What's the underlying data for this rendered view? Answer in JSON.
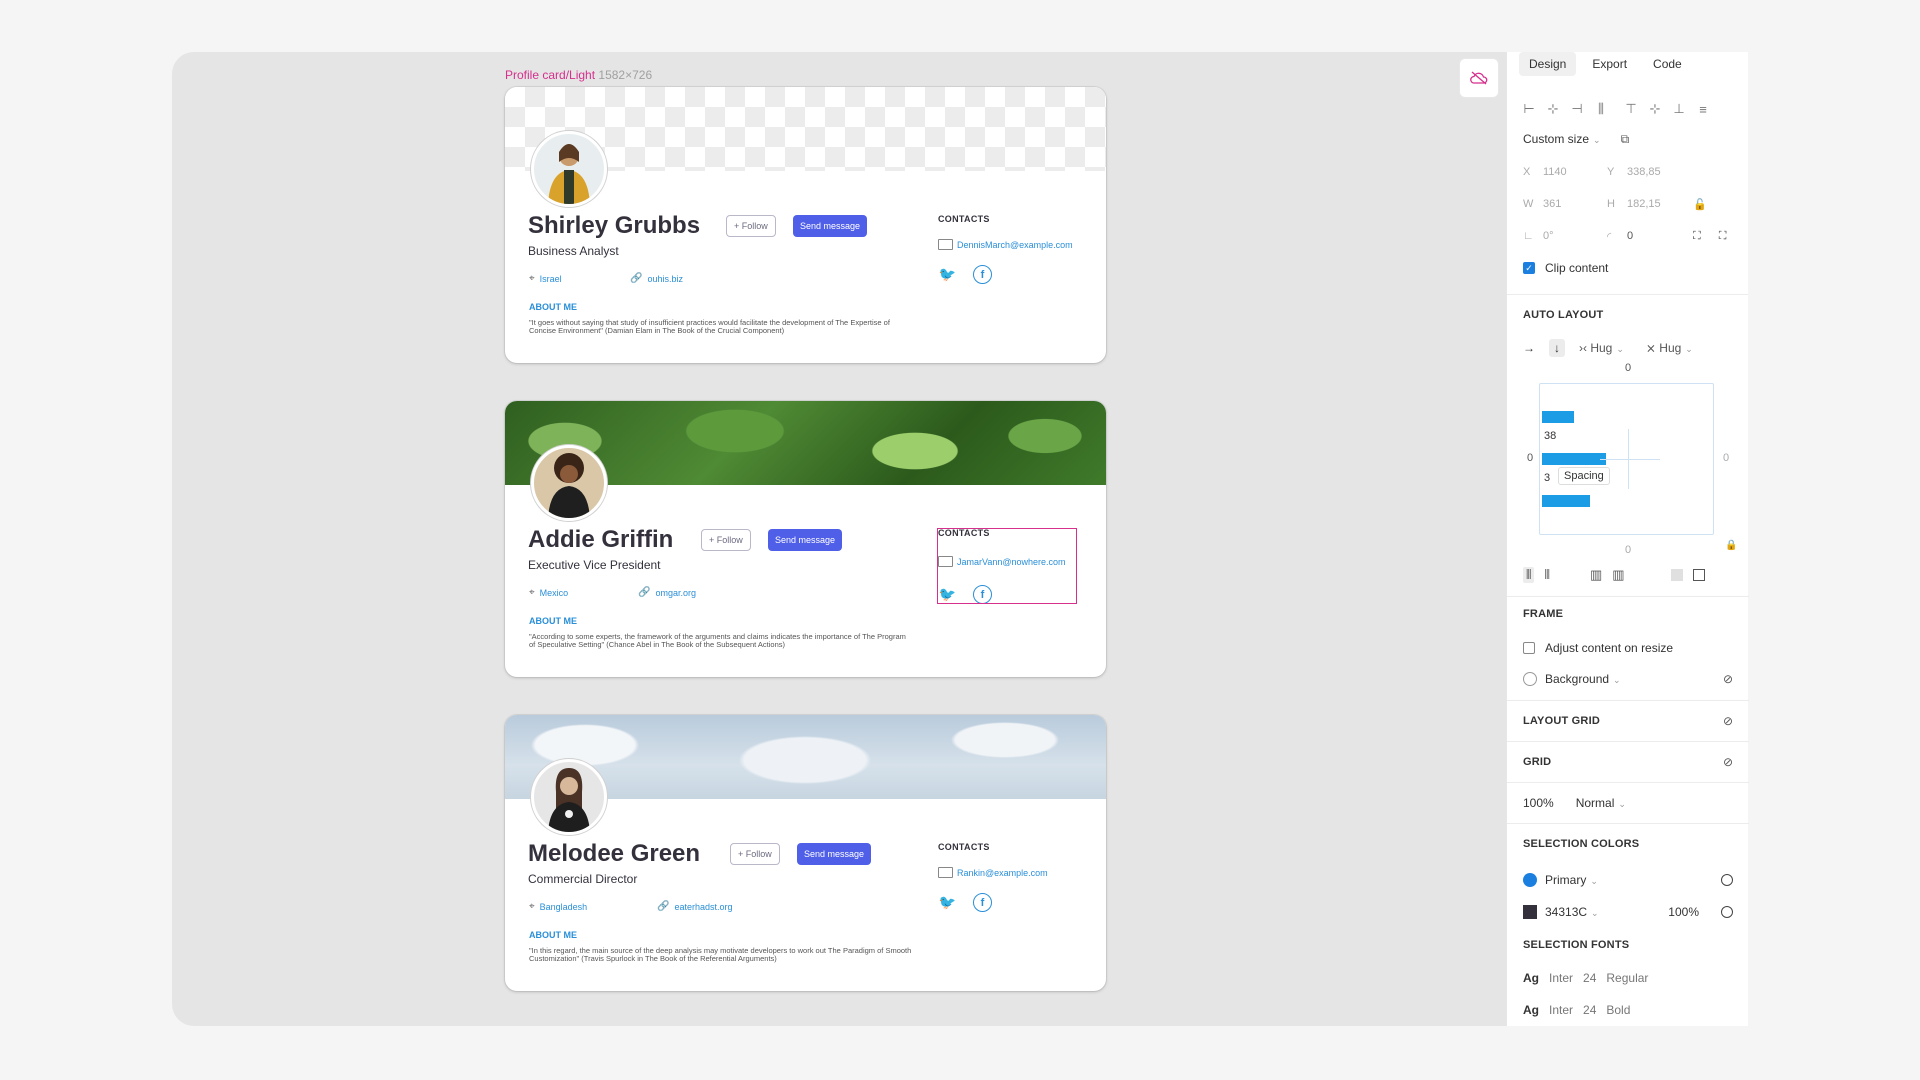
{
  "canvas": {
    "frame_label": "Profile card/Light",
    "frame_dims": "1582×726"
  },
  "cards": [
    {
      "name": "Shirley Grubbs",
      "role": "Business Analyst",
      "follow": "+ Follow",
      "message": "Send message",
      "location": "Israel",
      "website": "ouhis.biz",
      "about_heading": "ABOUT ME",
      "about": "\"It goes without saying that study of insufficient practices would facilitate the development of The Expertise of Concise Environment\" (Damian Elam in The Book of the Crucial Component)",
      "contacts_heading": "CONTACTS",
      "email": "DennisMarch@example.com"
    },
    {
      "name": "Addie Griffin",
      "role": "Executive Vice President",
      "follow": "+ Follow",
      "message": "Send message",
      "location": "Mexico",
      "website": "omgar.org",
      "about_heading": "ABOUT ME",
      "about": "\"According to some experts, the framework of the arguments and claims indicates the importance of The Program of Speculative Setting\" (Chance Abel in The Book of the Subsequent Actions)",
      "contacts_heading": "CONTACTS",
      "email": "JamarVann@nowhere.com"
    },
    {
      "name": "Melodee Green",
      "role": "Commercial Director",
      "follow": "+ Follow",
      "message": "Send message",
      "location": "Bangladesh",
      "website": "eaterhadst.org",
      "about_heading": "ABOUT ME",
      "about": "\"In this regard, the main source of the deep analysis may motivate developers to work out The Paradigm of Smooth Customization\" (Travis Spurlock in The Book of the Referential Arguments)",
      "contacts_heading": "CONTACTS",
      "email": "Rankin@example.com"
    }
  ],
  "panel": {
    "tabs": [
      "Design",
      "Export",
      "Code"
    ],
    "size_preset": "Custom size",
    "x_label": "X",
    "x_value": "1140",
    "y_label": "Y",
    "y_value": "338,85",
    "w_label": "W",
    "w_value": "361",
    "h_label": "H",
    "h_value": "182,15",
    "rotation": "0°",
    "radius": "0",
    "clip_content": "Clip content",
    "auto_layout_title": "AUTO LAYOUT",
    "hug_w": "Hug",
    "hug_h": "Hug",
    "pad_top": "0",
    "pad_left": "0",
    "pad_right": "0",
    "pad_bottom": "0",
    "spacing_value_a": "38",
    "spacing_value_b": "3",
    "spacing_tooltip": "Spacing",
    "frame_title": "FRAME",
    "adjust_content": "Adjust content on resize",
    "background": "Background",
    "layout_grid_title": "LAYOUT GRID",
    "grid_title": "GRID",
    "grid_opacity": "100%",
    "grid_mode": "Normal",
    "selection_colors_title": "SELECTION COLORS",
    "color1_name": "Primary",
    "color1_hex": "#1b7fe0",
    "color2_name": "34313C",
    "color2_hex": "#34313c",
    "color2_opacity": "100%",
    "selection_fonts_title": "SELECTION FONTS",
    "fonts": [
      {
        "sample": "Ag",
        "family": "Inter",
        "size": "24",
        "weight": "Regular"
      },
      {
        "sample": "Ag",
        "family": "Inter",
        "size": "24",
        "weight": "Bold"
      }
    ]
  }
}
